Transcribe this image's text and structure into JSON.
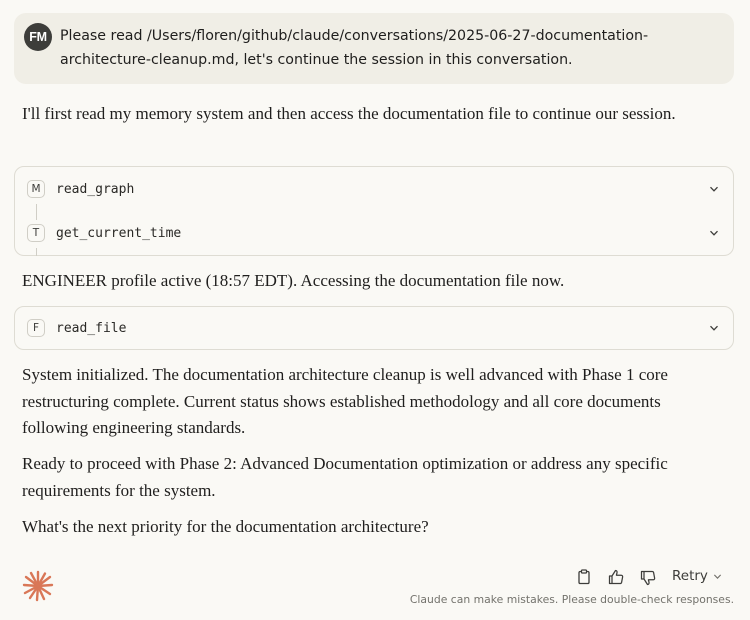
{
  "user_message": {
    "initials": "FM",
    "text_line1": "Please read /Users/floren/github/claude/conversations/2025-06-27-documentation-",
    "text_line2": "architecture-cleanup.md, let's continue the session in this conversation."
  },
  "assistant": {
    "intro": "I'll first read my memory system and then access the documentation file to continue our session.",
    "tool_group_1": [
      {
        "badge": "M",
        "name": "read_graph",
        "icon": "chevron-down-icon"
      },
      {
        "badge": "T",
        "name": "get_current_time",
        "icon": "chevron-down-icon"
      }
    ],
    "status_line": "ENGINEER profile active (18:57 EDT). Accessing the documentation file now.",
    "tool_group_2": [
      {
        "badge": "F",
        "name": "read_file",
        "icon": "chevron-down-icon"
      }
    ],
    "paragraph_1": "System initialized. The documentation architecture cleanup is well advanced with Phase 1 core restructuring complete. Current status shows established methodology and all core documents following engineering standards.",
    "paragraph_2": "Ready to proceed with Phase 2: Advanced Documentation optimization or address any specific requirements for the system.",
    "paragraph_3": "What's the next priority for the documentation architecture?"
  },
  "footer": {
    "retry_label": "Retry",
    "disclaimer": "Claude can make mistakes. Please double-check responses.",
    "icons": [
      "copy-icon",
      "thumbs-up-icon",
      "thumbs-down-icon"
    ]
  },
  "colors": {
    "background": "#faf9f5",
    "user_bubble": "#f0eee6",
    "avatar": "#3d3d3a",
    "brand_accent": "#d97757"
  }
}
